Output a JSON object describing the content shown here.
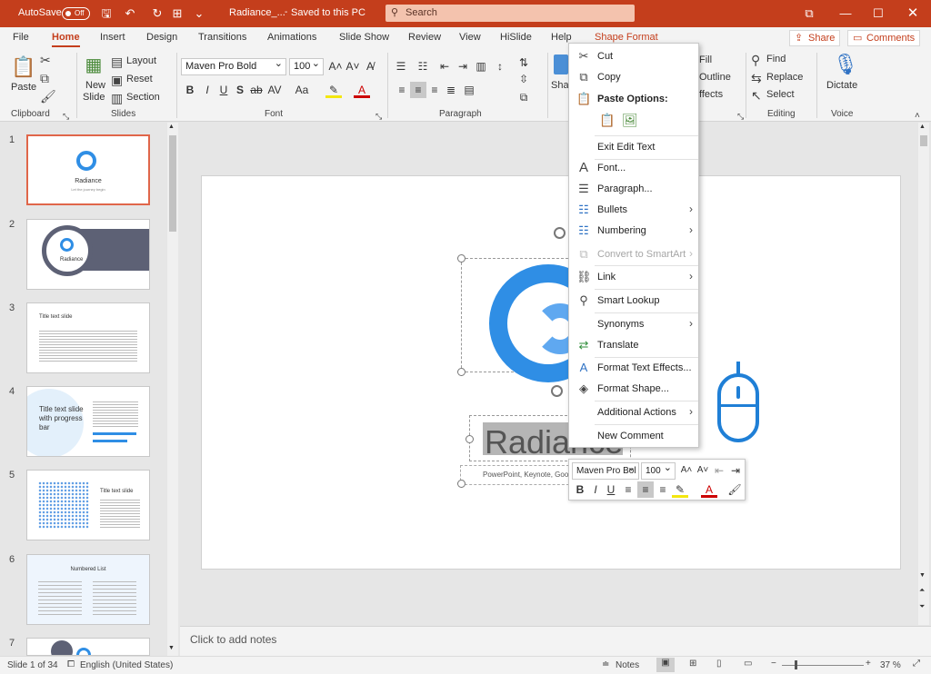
{
  "titlebar": {
    "autosave": "AutoSave",
    "autosave_state": "Off",
    "filename": "Radiance_...",
    "saved": "Saved to this PC",
    "search_placeholder": "Search"
  },
  "tabs": [
    "File",
    "Home",
    "Insert",
    "Design",
    "Transitions",
    "Animations",
    "Slide Show",
    "Review",
    "View",
    "HiSlide",
    "Help",
    "Shape Format"
  ],
  "share_label": "Share",
  "comments_label": "Comments",
  "ribbon": {
    "clipboard": {
      "paste": "Paste",
      "label": "Clipboard"
    },
    "slides": {
      "new_slide_1": "New",
      "new_slide_2": "Slide",
      "layout": "Layout",
      "reset": "Reset",
      "section": "Section",
      "label": "Slides"
    },
    "font": {
      "font_name": "Maven Pro Bold",
      "font_size": "100",
      "label": "Font"
    },
    "paragraph": {
      "label": "Paragraph"
    },
    "drawing": {
      "shapes_partial": "Shap",
      "fill_partial": "Fill",
      "outline_partial": "Outline",
      "effects_partial": "ffects"
    },
    "editing": {
      "find": "Find",
      "replace": "Replace",
      "select": "Select",
      "label": "Editing"
    },
    "voice": {
      "dictate": "Dictate",
      "label": "Voice"
    }
  },
  "thumbnails": [
    {
      "num": "1",
      "title": "Radiance",
      "sub": "Let the journey begin"
    },
    {
      "num": "2",
      "title": "Radiance",
      "sub": ""
    },
    {
      "num": "3",
      "title": "Title text slide",
      "sub": ""
    },
    {
      "num": "4",
      "title": "Title text slide with progress bar",
      "sub": ""
    },
    {
      "num": "5",
      "title": "Title text slide",
      "sub": ""
    },
    {
      "num": "6",
      "title": "Numbered List",
      "sub": ""
    },
    {
      "num": "7",
      "title": "",
      "sub": ""
    }
  ],
  "slide": {
    "title": "Radiance",
    "subtitle": "PowerPoint, Keynote, Google"
  },
  "context_menu": [
    {
      "label": "Cut",
      "icon": "scissors-icon",
      "type": "item"
    },
    {
      "label": "Copy",
      "icon": "copy-icon",
      "type": "item"
    },
    {
      "label": "Paste Options:",
      "icon": "paste-icon",
      "type": "header"
    },
    {
      "label": "Exit Edit Text",
      "icon": "",
      "type": "item"
    },
    {
      "label": "Font...",
      "icon": "font-icon",
      "type": "item"
    },
    {
      "label": "Paragraph...",
      "icon": "paragraph-icon",
      "type": "item"
    },
    {
      "label": "Bullets",
      "icon": "bullets-icon",
      "type": "submenu"
    },
    {
      "label": "Numbering",
      "icon": "numbering-icon",
      "type": "submenu"
    },
    {
      "label": "Convert to SmartArt",
      "icon": "smartart-icon",
      "type": "disabled"
    },
    {
      "label": "Link",
      "icon": "link-icon",
      "type": "submenu"
    },
    {
      "label": "Smart Lookup",
      "icon": "smart-lookup-icon",
      "type": "item"
    },
    {
      "label": "Synonyms",
      "icon": "",
      "type": "submenu"
    },
    {
      "label": "Translate",
      "icon": "translate-icon",
      "type": "item"
    },
    {
      "label": "Format Text Effects...",
      "icon": "text-effects-icon",
      "type": "item"
    },
    {
      "label": "Format Shape...",
      "icon": "format-shape-icon",
      "type": "item"
    },
    {
      "label": "Additional Actions",
      "icon": "",
      "type": "submenu"
    },
    {
      "label": "New Comment",
      "icon": "",
      "type": "item"
    }
  ],
  "mini_toolbar": {
    "font": "Maven Pro Bol",
    "size": "100"
  },
  "notes_placeholder": "Click to add notes",
  "statusbar": {
    "slide_info": "Slide 1 of 34",
    "language": "English (United States)",
    "notes": "Notes",
    "zoom": "37 %"
  },
  "colors": {
    "accent": "#c43e1c",
    "blue": "#2f8ee5"
  }
}
